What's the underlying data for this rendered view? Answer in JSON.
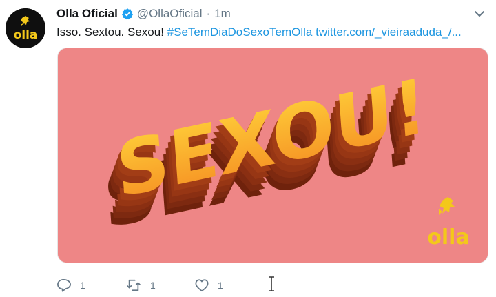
{
  "account": {
    "display_name": "Olla Oficial",
    "handle": "@OllaOficial",
    "separator": "·",
    "time": "1m",
    "verified": true,
    "avatar_text": "olla"
  },
  "tweet": {
    "text_before": "Isso. Sextou. Sexou! ",
    "hashtag": "#SeTemDiaDoSexoTemOlla",
    "link": "twitter.com/_vieiraaduda_/..."
  },
  "media": {
    "headline": "SEXOU!",
    "brand": "olla",
    "background_color": "#ee8686",
    "text_gradient_top": "#ffd23a",
    "text_gradient_bottom": "#f58c22",
    "shadow_color": "#8a2f12"
  },
  "actions": {
    "reply_count": "1",
    "retweet_count": "1",
    "like_count": "1"
  },
  "icons": {
    "verified": "verified-badge-icon",
    "caret": "chevron-down-icon",
    "reply": "reply-icon",
    "retweet": "retweet-icon",
    "like": "heart-icon",
    "cursor": "text-cursor-icon"
  },
  "colors": {
    "link": "#1b95e0",
    "muted": "#657786",
    "text": "#14171a"
  }
}
